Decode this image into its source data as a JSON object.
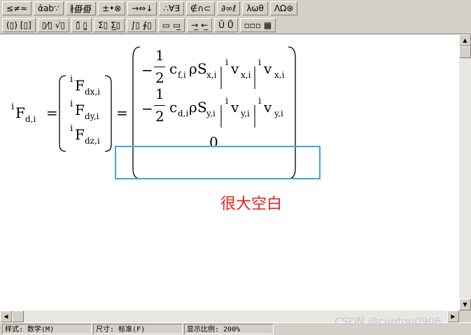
{
  "toolbar": {
    "row1": [
      "≤≠≈",
      "ἀab∵",
      "∦∰∰",
      "±•⊗",
      "→⇔↓",
      "∴∀∃",
      "∉∩⊂",
      "∂∞ℓ",
      "λωθ",
      "ΛΩ⊛"
    ],
    "row2": [
      "(▯) [▯]",
      "▯⁄▯ √▯",
      "▯̈ ▯̰",
      "Σ▯ Σ̲▯",
      "∫▯ ∮▯",
      "▭ ▭̲",
      "→̲ ←̲",
      "Ū Ů",
      "▫▫▫ ▦"
    ]
  },
  "equation": {
    "lhs": {
      "pre": "i",
      "base": "F",
      "sub": "d,i"
    },
    "eq1": "=",
    "col": [
      {
        "pre": "i",
        "base": "F",
        "sub": "dx,i"
      },
      {
        "pre": "i",
        "base": "F",
        "sub": "dy,i"
      },
      {
        "pre": "i",
        "base": "F",
        "sub": "dz,i"
      }
    ],
    "eq2": "=",
    "row1": {
      "minus": "−",
      "num": "1",
      "den": "2",
      "c": "c",
      "csub": "f,i",
      "rho": "ρ",
      "S": "S",
      "ssub": "x,i",
      "pre1": "i",
      "v1": "v",
      "v1sub": "x,i",
      "pre2": "i",
      "v2": "v",
      "v2sub": "x,i"
    },
    "row2": {
      "minus": "−",
      "num": "1",
      "den": "2",
      "c": "c",
      "csub": "d,i",
      "rho": "ρ",
      "S": "S",
      "ssub": "y,i",
      "pre1": "i",
      "v1": "v",
      "v1sub": "y,i",
      "pre2": "i",
      "v2": "v",
      "v2sub": "y,i"
    },
    "row3": "0"
  },
  "annotation": {
    "text": "很大空白",
    "color": "#e8201c",
    "box_color": "#3ea8d8"
  },
  "statusbar": {
    "style": "样式: 数学(M)",
    "size": "尺寸: 标准(F)",
    "zoom": "显示比例: 200%"
  },
  "watermark": "CSDN @cuntou0906"
}
